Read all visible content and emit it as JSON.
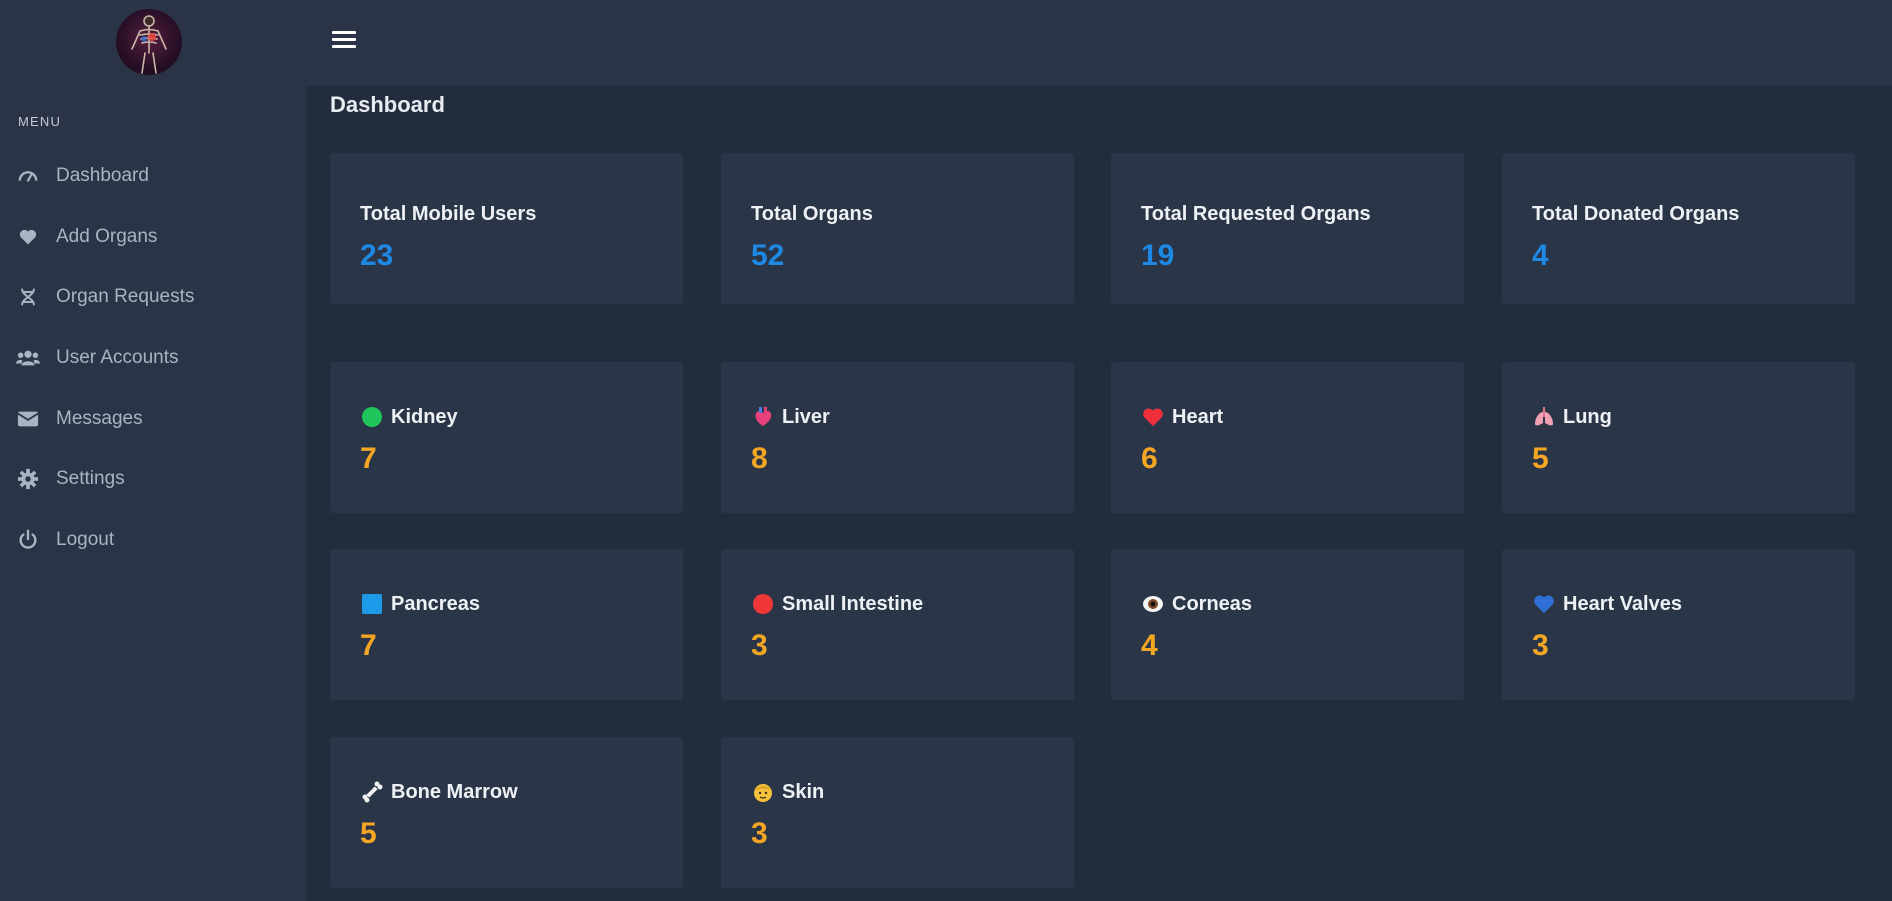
{
  "sidebar": {
    "menu_heading": "MENU",
    "items": [
      {
        "label": "Dashboard",
        "icon": "gauge-icon"
      },
      {
        "label": "Add Organs",
        "icon": "heart-icon"
      },
      {
        "label": "Organ Requests",
        "icon": "dna-icon"
      },
      {
        "label": "User Accounts",
        "icon": "users-icon"
      },
      {
        "label": "Messages",
        "icon": "envelope-icon"
      },
      {
        "label": "Settings",
        "icon": "gear-icon"
      },
      {
        "label": "Logout",
        "icon": "power-icon"
      }
    ]
  },
  "page": {
    "title": "Dashboard"
  },
  "stats": [
    {
      "label": "Total Mobile Users",
      "value": "23"
    },
    {
      "label": "Total Organs",
      "value": "52"
    },
    {
      "label": "Total Requested Organs",
      "value": "19"
    },
    {
      "label": "Total Donated Organs",
      "value": "4"
    }
  ],
  "organs": [
    {
      "label": "Kidney",
      "value": "7",
      "icon": "green-circle-icon"
    },
    {
      "label": "Liver",
      "value": "8",
      "icon": "anatomical-heart-icon"
    },
    {
      "label": "Heart",
      "value": "6",
      "icon": "red-heart-icon"
    },
    {
      "label": "Lung",
      "value": "5",
      "icon": "lungs-icon"
    },
    {
      "label": "Pancreas",
      "value": "7",
      "icon": "blue-square-icon"
    },
    {
      "label": "Small Intestine",
      "value": "3",
      "icon": "red-circle-icon"
    },
    {
      "label": "Corneas",
      "value": "4",
      "icon": "eye-icon"
    },
    {
      "label": "Heart Valves",
      "value": "3",
      "icon": "blue-heart-icon"
    },
    {
      "label": "Bone Marrow",
      "value": "5",
      "icon": "bone-icon"
    },
    {
      "label": "Skin",
      "value": "3",
      "icon": "face-icon"
    }
  ],
  "colors": {
    "sidebar_bg": "#2a3446",
    "page_bg": "#232c3d",
    "card_bg": "#2b3548",
    "stat_value": "#1e88e5",
    "organ_value": "#f5a623"
  }
}
